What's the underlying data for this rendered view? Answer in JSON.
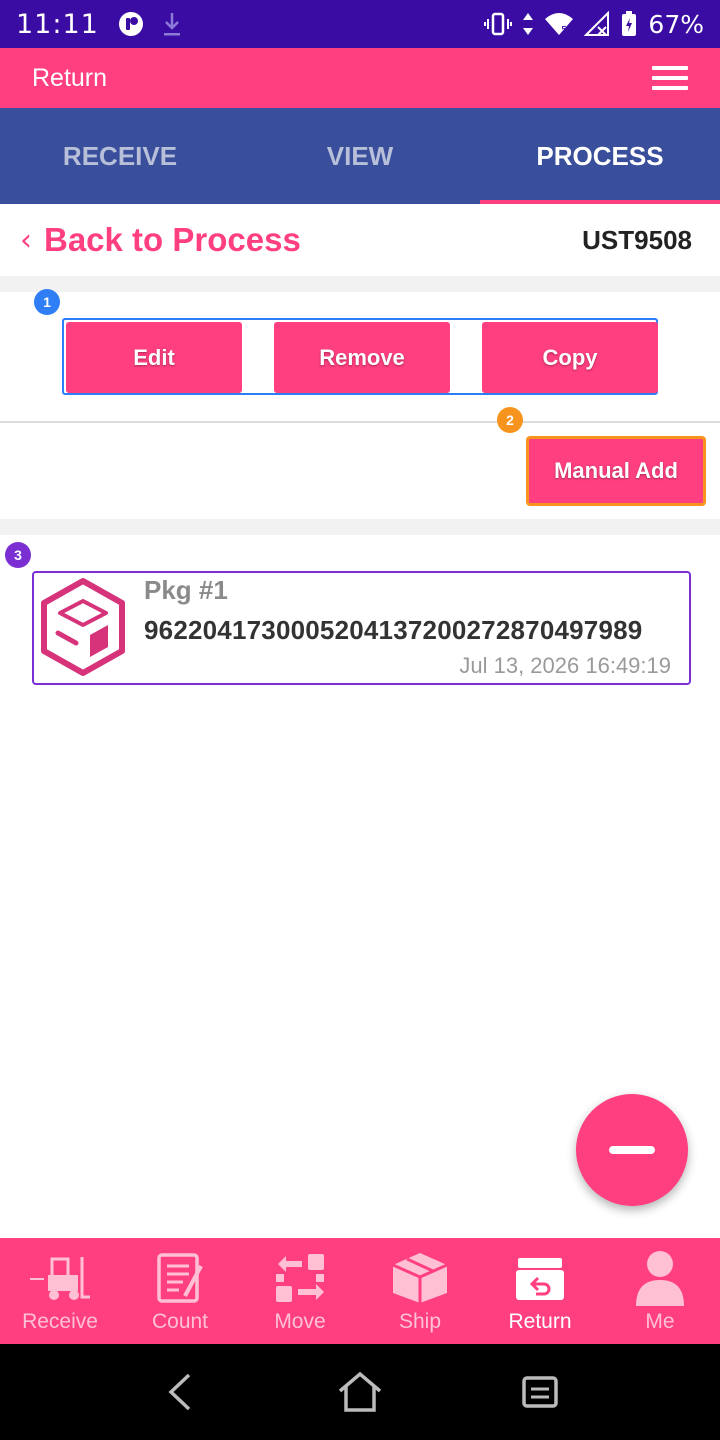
{
  "status_bar": {
    "time": "11:11",
    "battery": "67%"
  },
  "app_bar": {
    "title": "Return"
  },
  "tabs": [
    {
      "label": "RECEIVE",
      "active": false
    },
    {
      "label": "VIEW",
      "active": false
    },
    {
      "label": "PROCESS",
      "active": true
    }
  ],
  "back_row": {
    "back_label": "Back to Process",
    "order_id": "UST9508"
  },
  "badges": [
    "1",
    "2",
    "3"
  ],
  "actions": {
    "edit": "Edit",
    "remove": "Remove",
    "copy": "Copy",
    "manual_add": "Manual Add"
  },
  "package": {
    "title": "Pkg #1",
    "tracking": "9622041730005204137200272870497989",
    "timestamp": "Jul 13, 2026 16:49:19"
  },
  "bottom_nav": [
    {
      "label": "Receive",
      "icon": "forklift-icon",
      "active": false
    },
    {
      "label": "Count",
      "icon": "clipboard-icon",
      "active": false
    },
    {
      "label": "Move",
      "icon": "move-arrows-icon",
      "active": false
    },
    {
      "label": "Ship",
      "icon": "box-icon",
      "active": false
    },
    {
      "label": "Return",
      "icon": "return-box-icon",
      "active": true
    },
    {
      "label": "Me",
      "icon": "person-icon",
      "active": false
    }
  ],
  "colors": {
    "status_bar": "#3a0ca3",
    "brand_pink": "#ff3f80",
    "tab_bar": "#3a4f9c",
    "badge_blue": "#2f7ef5",
    "badge_orange": "#f7941d",
    "badge_purple": "#7b2fd3"
  }
}
